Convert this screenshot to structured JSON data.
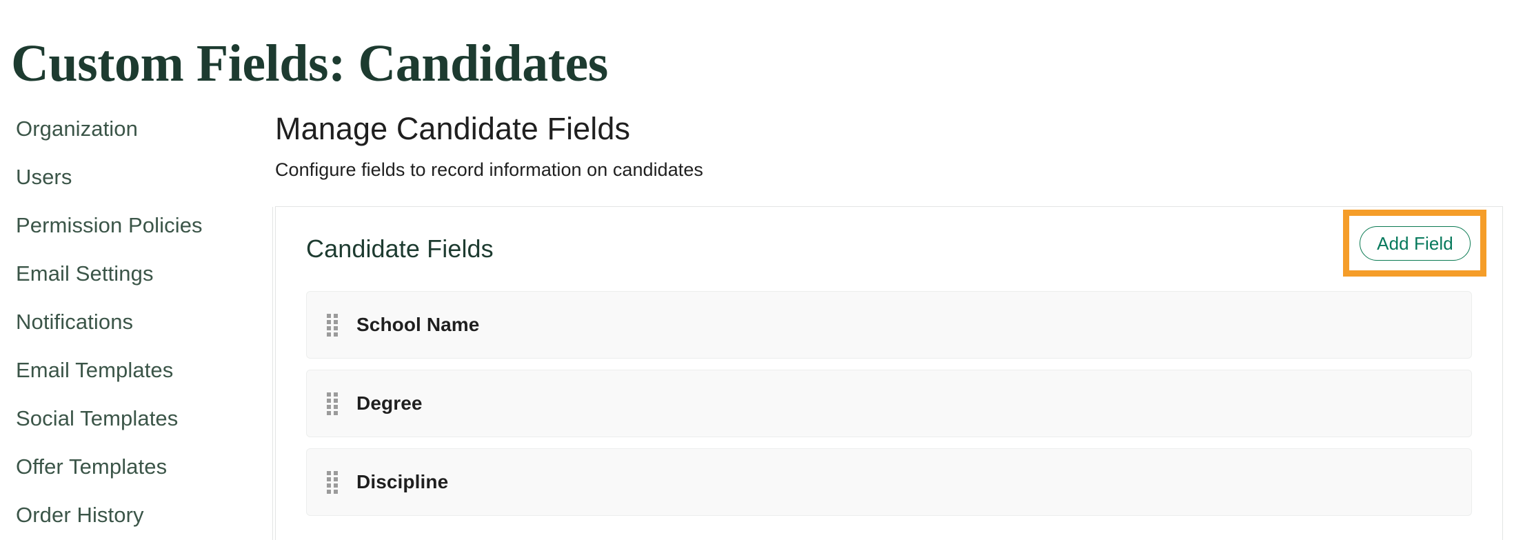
{
  "page": {
    "title": "Custom Fields: Candidates",
    "title_color": "#1d3b30",
    "background": "#ffffff"
  },
  "sidebar": {
    "items": [
      {
        "label": "Organization"
      },
      {
        "label": "Users"
      },
      {
        "label": "Permission Policies"
      },
      {
        "label": "Email Settings"
      },
      {
        "label": "Notifications"
      },
      {
        "label": "Email Templates"
      },
      {
        "label": "Social Templates"
      },
      {
        "label": "Offer Templates"
      },
      {
        "label": "Order History"
      }
    ],
    "link_color": "#3b5548"
  },
  "main": {
    "heading": "Manage Candidate Fields",
    "subheading": "Configure fields to record information on candidates",
    "card": {
      "title": "Candidate Fields",
      "title_color": "#1d3b30",
      "add_field_label": "Add Field",
      "add_field_color": "#07795c",
      "highlight_color": "#f59d29",
      "fields": [
        {
          "label": "School Name",
          "handle_icon": "drag-handle-icon"
        },
        {
          "label": "Degree",
          "handle_icon": "drag-handle-icon"
        },
        {
          "label": "Discipline",
          "handle_icon": "drag-handle-icon"
        }
      ]
    }
  }
}
